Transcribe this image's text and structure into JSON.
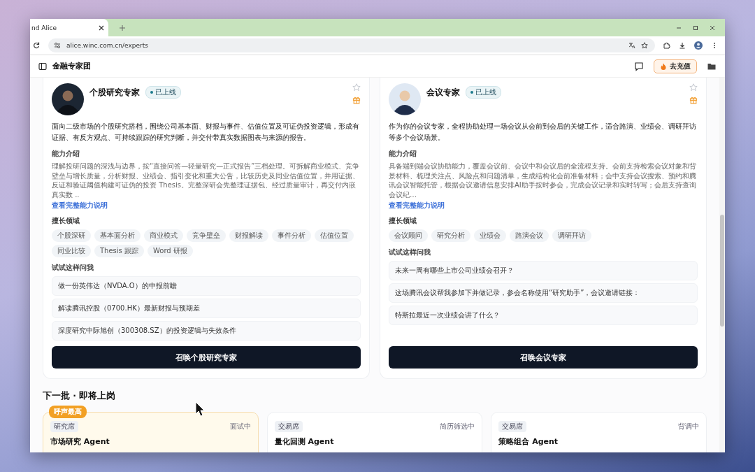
{
  "browser": {
    "tab_title": "nd Alice",
    "url": "alice.winc.com.cn/experts"
  },
  "app": {
    "title": "金融专家团",
    "recharge_button": "去充值"
  },
  "experts": [
    {
      "name": "个股研究专家",
      "status": "已上线",
      "favorited": false,
      "description": "面向二级市场的个股研究搭档，围绕公司基本面、财报与事件、估值位置及可证伪投资逻辑，形成有证据、有反方观点、可持续跟踪的研究判断，并交付带真实数据图表与来源的报告。",
      "capability_heading": "能力介绍",
      "capability": "理解投研问题的深浅与边界，按“直接问答—轻量研究—正式报告”三档处理。可拆解商业模式、竞争壁垒与增长质量，分析财报、业绩会、指引变化和重大公告，比较历史及同业估值位置，并用证据、反证和验证阈值构建可证伪的投资 Thesis。完整深研会先整理证据包、经过质量审计，再交付内嵌真实数 ..",
      "more_link": "查看完整能力说明",
      "domains_heading": "擅长领域",
      "tags": [
        "个股深研",
        "基本面分析",
        "商业模式",
        "竞争壁垒",
        "财报解读",
        "事件分析",
        "估值位置",
        "同业比较",
        "Thesis 跟踪",
        "Word 研报"
      ],
      "questions_heading": "试试这样问我",
      "questions": [
        "做一份英伟达（NVDA.O）的中报前瞻",
        "解读腾讯控股（0700.HK）最新财报与预期差",
        "深度研究中际旭创（300308.SZ）的投资逻辑与失效条件"
      ],
      "summon_button": "召唤个股研究专家"
    },
    {
      "name": "会议专家",
      "status": "已上线",
      "favorited": false,
      "description": "作为你的会议专家，全程协助处理一场会议从会前到会后的关键工作，适合路演、业绩会、调研拜访等多个会议场景。",
      "capability_heading": "能力介绍",
      "capability": "具备端到端会议协助能力，覆盖会议前、会议中和会议后的全流程支持。会前支持检索会议对象和背景材料、梳理关注点、风险点和问题清单，生成结构化会前准备材料；会中支持会议搜索、预约和腾讯会议智能托管，根据会议邀请信息安排AI助手按时参会，完成会议记录和实时转写；会后支持查询会议纪…",
      "more_link": "查看完整能力说明",
      "domains_heading": "擅长领域",
      "tags": [
        "会议顾问",
        "研究分析",
        "业绩会",
        "路演会议",
        "调研拜访"
      ],
      "questions_heading": "试试这样问我",
      "questions": [
        "未来一周有哪些上市公司业绩会召开？",
        "这场腾讯会议帮我参加下并做记录，参会名称使用“研究助手”，会议邀请链接：",
        "特斯拉最近一次业绩会讲了什么？"
      ],
      "summon_button": "召唤会议专家"
    }
  ],
  "next_batch": {
    "title": "下一批 · 即将上岗",
    "agents": [
      {
        "featured": true,
        "badge": "呼声最高",
        "seat": "研究席",
        "status": "面试中",
        "name": "市场研究 Agent"
      },
      {
        "featured": false,
        "seat": "交易席",
        "status": "简历筛选中",
        "name": "量化回测 Agent"
      },
      {
        "featured": false,
        "seat": "交易席",
        "status": "背调中",
        "name": "策略组合 Agent"
      }
    ]
  }
}
